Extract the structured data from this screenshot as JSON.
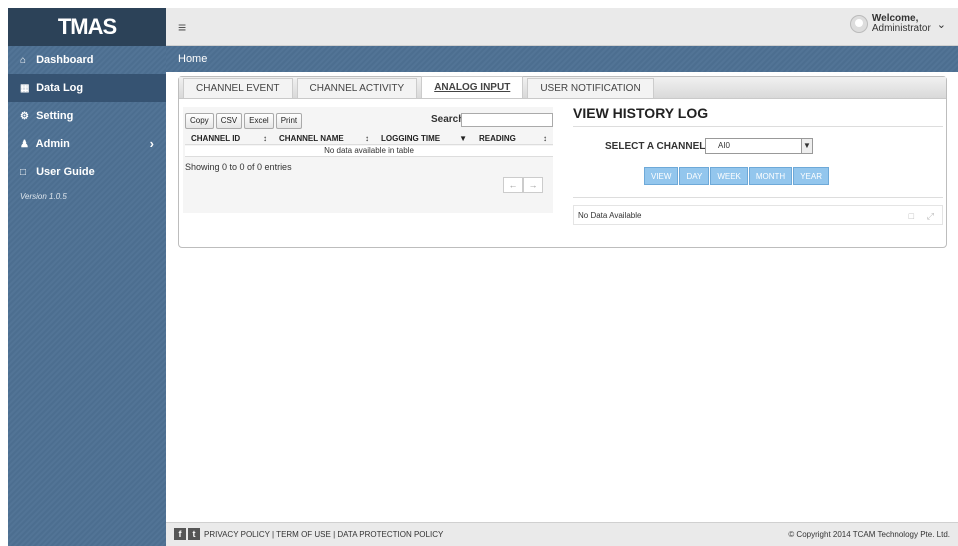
{
  "app": {
    "logo": "TMAS",
    "version": "Version 1.0.5"
  },
  "sidebar": {
    "items": [
      {
        "label": "Dashboard",
        "icon": "home-icon"
      },
      {
        "label": "Data Log",
        "icon": "table-icon"
      },
      {
        "label": "Setting",
        "icon": "gear-icon"
      },
      {
        "label": "Admin",
        "icon": "user-icon"
      },
      {
        "label": "User Guide",
        "icon": "document-icon"
      }
    ]
  },
  "header": {
    "welcome": "Welcome,",
    "user": "Administrator"
  },
  "breadcrumb": "Home",
  "tabs": [
    "CHANNEL EVENT",
    "CHANNEL ACTIVITY",
    "ANALOG INPUT",
    "USER NOTIFICATION"
  ],
  "table": {
    "buttons": [
      "Copy",
      "CSV",
      "Excel",
      "Print"
    ],
    "search_label": "Search:",
    "columns": [
      "CHANNEL ID",
      "CHANNEL NAME",
      "LOGGING TIME",
      "READING"
    ],
    "empty": "No data available in table",
    "info": "Showing 0 to 0 of 0 entries",
    "prev": "←",
    "next": "→"
  },
  "history": {
    "title": "VIEW HISTORY LOG",
    "channel_label": "SELECT A CHANNEL:",
    "channel_value": "AI0",
    "ranges": [
      "VIEW",
      "DAY",
      "WEEK",
      "MONTH",
      "YEAR"
    ],
    "no_data": "No Data Available"
  },
  "footer": {
    "links": "PRIVACY POLICY | TERM OF USE | DATA PROTECTION POLICY",
    "copyright": "© Copyright 2014 TCAM Technology Pte. Ltd."
  }
}
